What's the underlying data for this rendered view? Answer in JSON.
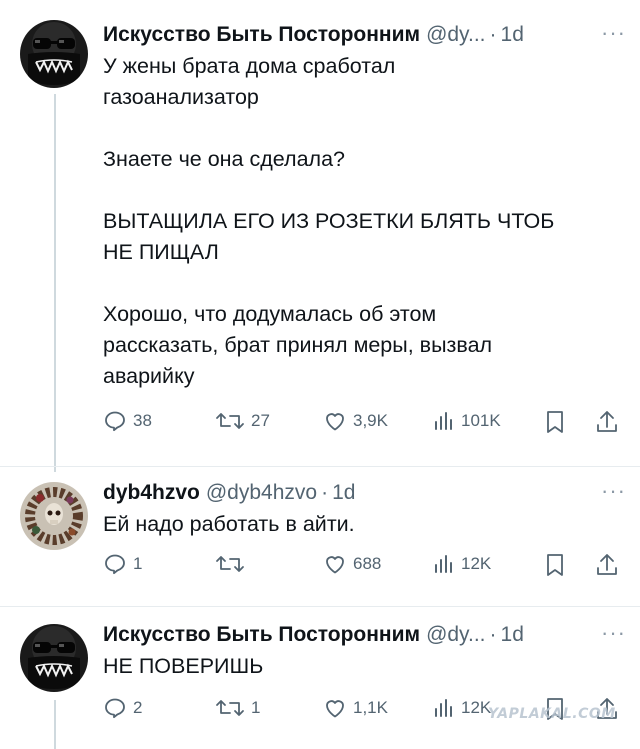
{
  "tweets": [
    {
      "author_name": "Искусство Быть Посторонним",
      "handle": "@dy...",
      "time": "1d",
      "text": "У жены брата дома сработал\nгазоанализатор\n\nЗнаете че она сделала?\n\nВЫТАЩИЛА ЕГО ИЗ РОЗЕТКИ БЛЯТЬ ЧТОБ\nНЕ ПИЩАЛ\n\nХорошо, что додумалась об этом\nрассказать, брат принял меры, вызвал\nаварийку",
      "replies": "38",
      "retweets": "27",
      "likes": "3,9K",
      "views": "101K"
    },
    {
      "author_name": "dyb4hzvo",
      "handle": "@dyb4hzvo",
      "time": "1d",
      "text": "Ей надо работать в айти.",
      "replies": "1",
      "retweets": "",
      "likes": "688",
      "views": "12K"
    },
    {
      "author_name": "Искусство Быть Посторонним",
      "handle": "@dy...",
      "time": "1d",
      "text": "НЕ ПОВЕРИШЬ",
      "replies": "2",
      "retweets": "1",
      "likes": "1,1K",
      "views": "12K"
    }
  ],
  "ui": {
    "dot": "·",
    "more": "···",
    "watermark": "YAPLAKAL.COM"
  },
  "colors": {
    "text": "#0f1419",
    "secondary": "#536471",
    "thread_line": "#cfd9de"
  }
}
